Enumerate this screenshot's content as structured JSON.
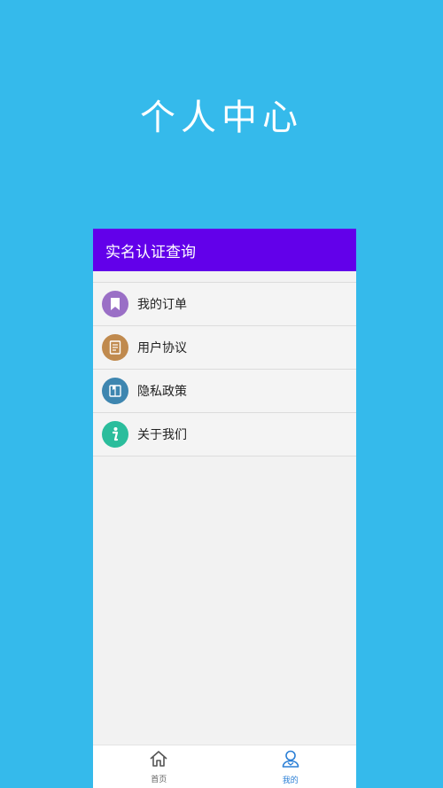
{
  "banner": {
    "title": "个人中心"
  },
  "appbar": {
    "title": "实名认证查询",
    "color": "#6200ea"
  },
  "menu": [
    {
      "label": "我的订单",
      "icon": "bookmark-icon",
      "color": "#9a6fc6"
    },
    {
      "label": "用户协议",
      "icon": "document-icon",
      "color": "#c08a4e"
    },
    {
      "label": "隐私政策",
      "icon": "book-icon",
      "color": "#3e86b0"
    },
    {
      "label": "关于我们",
      "icon": "info-icon",
      "color": "#2bbd9c"
    }
  ],
  "tabbar": {
    "home": {
      "label": "首页",
      "icon": "home-icon",
      "color": "#666666"
    },
    "mine": {
      "label": "我的",
      "icon": "user-icon",
      "color": "#2b7fd6",
      "active": true
    }
  }
}
